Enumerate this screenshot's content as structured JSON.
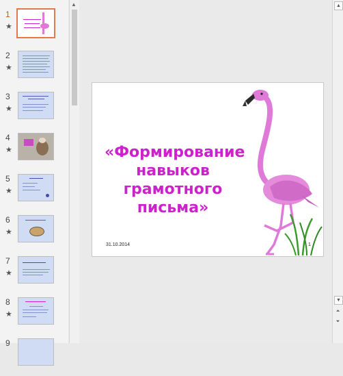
{
  "slides": [
    {
      "number": "1",
      "star": "★"
    },
    {
      "number": "2",
      "star": "★"
    },
    {
      "number": "3",
      "star": "★"
    },
    {
      "number": "4",
      "star": "★"
    },
    {
      "number": "5",
      "star": "★"
    },
    {
      "number": "6",
      "star": "★"
    },
    {
      "number": "7",
      "star": "★"
    },
    {
      "number": "8",
      "star": "★"
    },
    {
      "number": "9",
      "star": ""
    }
  ],
  "current_slide": {
    "title": "«Формирование навыков грамотного письма»",
    "date": "31.10.2014",
    "page_number": "1"
  },
  "colors": {
    "title": "#cc22cc",
    "selection": "#e07a4a",
    "flamingo": "#e07ad8"
  },
  "icons": [
    "scroll-up-arrow-icon",
    "scroll-down-arrow-icon",
    "previous-slide-icon",
    "next-slide-icon",
    "flamingo-illustration"
  ]
}
